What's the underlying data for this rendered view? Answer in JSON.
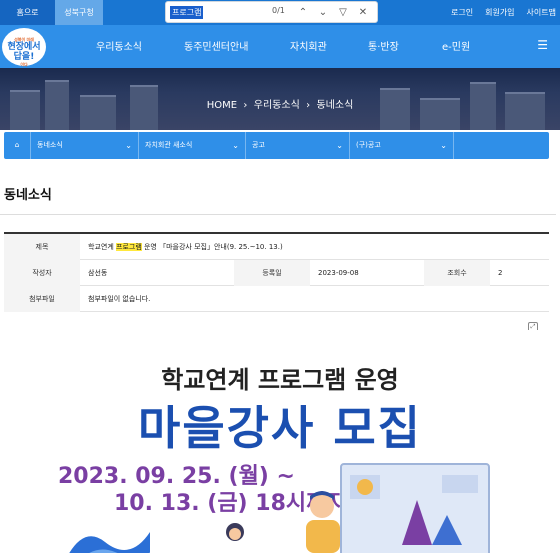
{
  "topbar": {
    "tabs": [
      "홈으로",
      "성북구청"
    ],
    "find": {
      "query": "프로그램",
      "count": "0/1"
    },
    "links": [
      "로그인",
      "회원가입",
      "사이트맵"
    ]
  },
  "nav": {
    "logo_small": "성북이 미래",
    "logo_main": "현장에서 답을!",
    "logo_sub": "이다",
    "items": [
      "우리동소식",
      "동주민센터안내",
      "자치회관",
      "통·반장",
      "e-민원"
    ]
  },
  "breadcrumb": [
    "HOME",
    "우리동소식",
    "동네소식"
  ],
  "subnav": {
    "cells": [
      "동네소식",
      "자치회관 새소식",
      "공고",
      "(구)공고"
    ]
  },
  "page_title": "동네소식",
  "post": {
    "subject_label": "제목",
    "subject_before": "학교연계 ",
    "subject_hl": "프로그램",
    "subject_after": " 운영 「마을강사 모집」안내(9. 25.~10. 13.)",
    "author_label": "작성자",
    "author": "삼선동",
    "date_label": "등록일",
    "date": "2023-09-08",
    "views_label": "조회수",
    "views": "2",
    "attach_label": "첨부파일",
    "attach": "첨부파일이 없습니다."
  },
  "poster": {
    "subtitle": "학교연계 프로그램 운영",
    "title": "마을강사 모집",
    "date_line1": "2023. 09. 25. (월) ~",
    "date_line2": "10. 13. (금) 18시까지"
  },
  "colors": {
    "accent": "#2f8fe8",
    "topbar": "#1976d2",
    "highlight": "#ffe83c",
    "poster_title": "#1b4fb0",
    "poster_date": "#7a3fa3"
  }
}
